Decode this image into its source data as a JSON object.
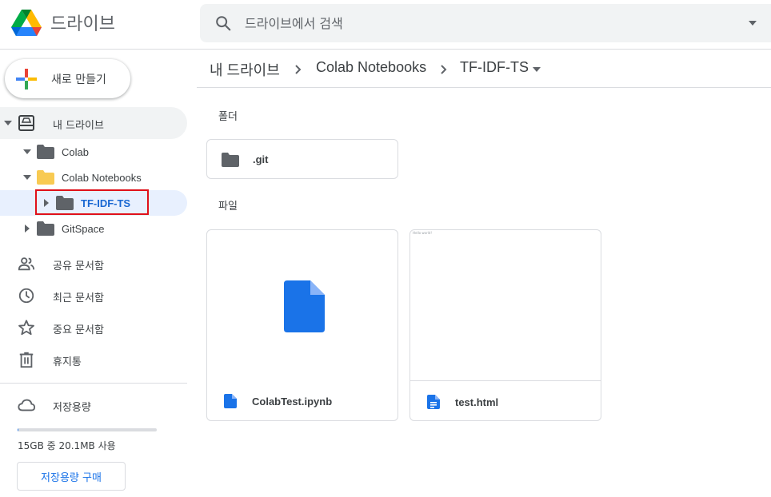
{
  "app": {
    "name": "드라이브",
    "search_placeholder": "드라이브에서 검색"
  },
  "sidebar": {
    "new_button": "새로 만들기",
    "my_drive": "내 드라이브",
    "tree": [
      {
        "label": "Colab",
        "expanded": true
      },
      {
        "label": "Colab Notebooks",
        "expanded": true
      },
      {
        "label": "TF-IDF-TS",
        "expanded": false,
        "selected": true
      },
      {
        "label": "GitSpace",
        "expanded": false
      }
    ],
    "nav": [
      {
        "label": "공유 문서함",
        "icon": "people-icon"
      },
      {
        "label": "최근 문서함",
        "icon": "clock-icon"
      },
      {
        "label": "중요 문서함",
        "icon": "star-icon"
      },
      {
        "label": "휴지통",
        "icon": "trash-icon"
      }
    ],
    "storage": {
      "label": "저장용량",
      "usage_text": "15GB 중 20.1MB 사용",
      "used_fraction": 0.0013,
      "buy_button": "저장용량 구매"
    }
  },
  "breadcrumb": [
    "내 드라이브",
    "Colab Notebooks",
    "TF-IDF-TS"
  ],
  "main": {
    "folders_label": "폴더",
    "files_label": "파일",
    "folders": [
      {
        "name": ".git"
      }
    ],
    "files": [
      {
        "name": "ColabTest.ipynb",
        "icon": "doc-icon"
      },
      {
        "name": "test.html",
        "icon": "doc-lines-icon",
        "preview_text": "Hello world!"
      }
    ]
  },
  "colors": {
    "accent": "#1a73e8",
    "folder_gray": "#5f6368",
    "folder_yellow": "#f8ca52",
    "highlight_border": "#e0101a"
  }
}
